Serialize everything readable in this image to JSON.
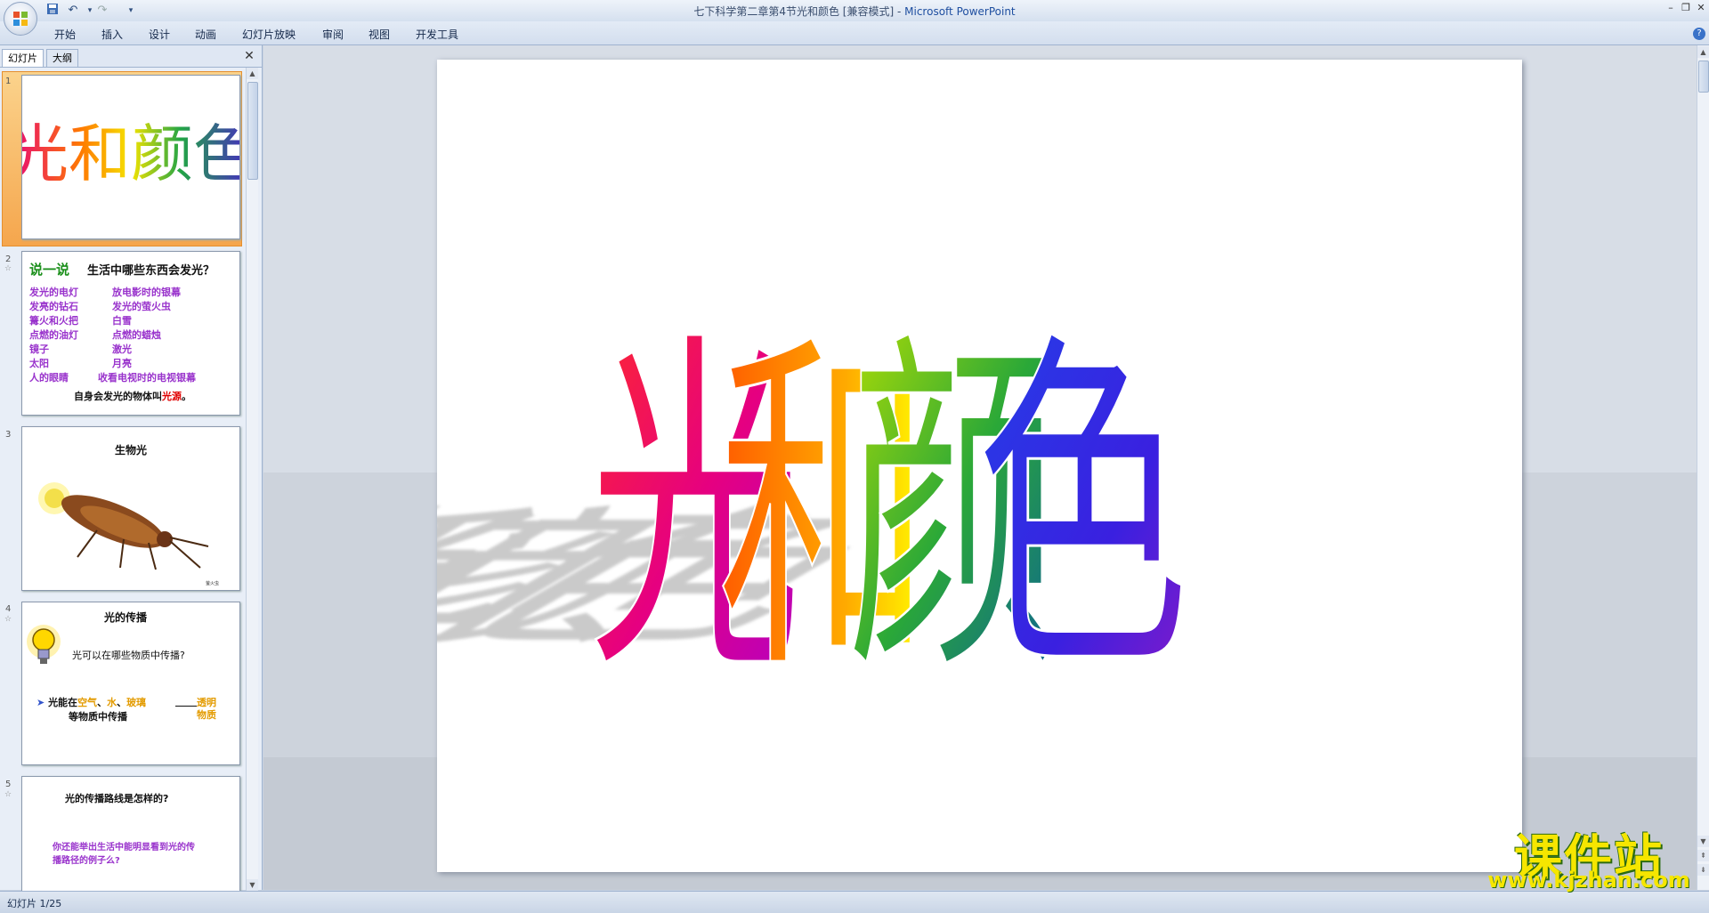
{
  "window": {
    "title": "七下科学第二章第4节光和颜色 [兼容模式]",
    "app_name": "Microsoft PowerPoint",
    "separator": " - "
  },
  "quick_access": {
    "save_icon": "save-icon",
    "undo_icon": "undo-icon",
    "redo_icon": "redo-icon",
    "customize_icon": "dropdown-icon"
  },
  "ribbon": {
    "tabs": [
      "开始",
      "插入",
      "设计",
      "动画",
      "幻灯片放映",
      "审阅",
      "视图",
      "开发工具"
    ]
  },
  "panel": {
    "tab_slides": "幻灯片",
    "tab_outline": "大纲",
    "close_glyph": "✕"
  },
  "thumbnails": [
    {
      "num": "1",
      "title": "光和颜色"
    },
    {
      "num": "2",
      "heading": "说一说",
      "question": "生活中哪些东西会发光？",
      "left_items": [
        "发光的电灯",
        "发亮的钻石",
        "篝火和火把",
        "点燃的油灯",
        "镜子",
        "太阳",
        "人的眼睛"
      ],
      "right_items": [
        "放电影时的银幕",
        "发光的萤火虫",
        "白雪",
        "点燃的蜡烛",
        "激光",
        "月亮",
        "收看电视时的电视银幕"
      ],
      "conclusion_prefix": "自身会发光的物体叫",
      "conclusion_keyword": "光源",
      "conclusion_suffix": "。"
    },
    {
      "num": "3",
      "title": "生物光",
      "caption": "萤火虫"
    },
    {
      "num": "4",
      "title": "光的传播",
      "question": "光可以在哪些物质中传播?",
      "bullet": "➤",
      "line1_a": "光能在",
      "line1_air": "空气",
      "line1_sep1": "、",
      "line1_water": "水",
      "line1_sep2": "、",
      "line1_glass": "玻璃",
      "line2": "等物质中传播",
      "side1": "透明",
      "side2": "物质"
    },
    {
      "num": "5",
      "title": "光的传播路线是怎样的?",
      "body1": "你还能举出生活中能明显看到光的传",
      "body2": "播路径的例子么?"
    }
  ],
  "slide": {
    "title_chars": [
      "光",
      "和",
      "颜",
      "色"
    ]
  },
  "status": {
    "slide_indicator": "幻灯片 1/25"
  },
  "watermark": {
    "brand": "课件站",
    "url": "www.kjzhan.com"
  },
  "colors": {
    "accent": "#1f4fa0",
    "selected_thumb": "#f5a64d",
    "purple_text": "#9933cc",
    "green_heading": "#1a8f1a",
    "orange_text": "#e39b00",
    "red_keyword": "#e00000"
  }
}
